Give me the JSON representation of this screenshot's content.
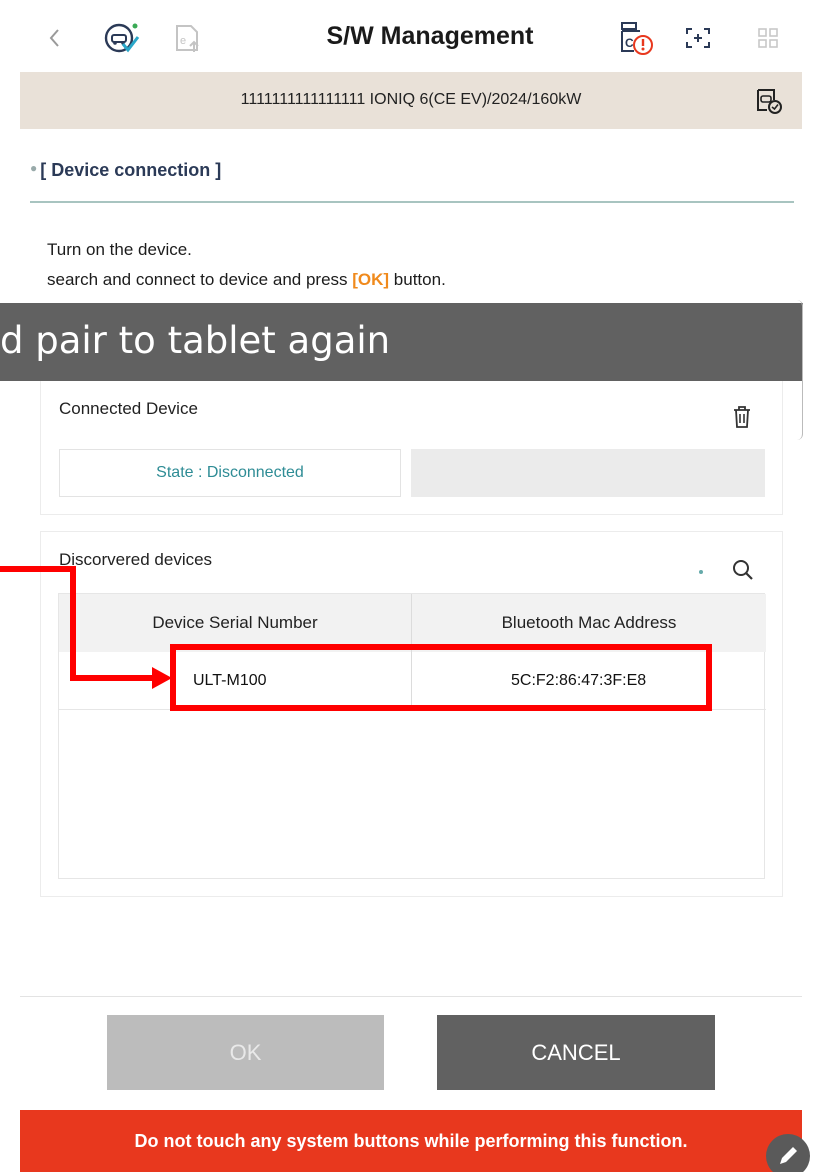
{
  "header": {
    "title": "S/W Management",
    "icons": [
      "back-chevron-icon",
      "car-repair-check-icon",
      "ecu-upload-icon",
      "vci-alert-icon",
      "screen-capture-icon",
      "grid-menu-icon"
    ],
    "vci_icon_text": "C"
  },
  "vehicle_bar": {
    "text": "1111111111111111  IONIQ 6(CE EV)/2024/160kW",
    "icon": "vehicle-status-icon"
  },
  "section": {
    "title": "[ Device connection ]"
  },
  "instructions": {
    "line1": "Turn on the device.",
    "line2_prefix": "search and connect to device and press ",
    "line2_ok": "[OK]",
    "line2_suffix": " button."
  },
  "overlay_caption": "d pair to tablet again",
  "connected_device": {
    "title": "Connected Device",
    "state": "State : Disconnected",
    "delete_icon": "trash-icon"
  },
  "discovered_devices": {
    "title": "Discorvered devices",
    "search_icon": "search-icon",
    "columns": [
      "Device Serial Number",
      "Bluetooth Mac Address"
    ],
    "rows": [
      {
        "serial": "ULT-M100",
        "mac": "5C:F2:86:47:3F:E8"
      }
    ]
  },
  "buttons": {
    "ok": "OK",
    "cancel": "CANCEL"
  },
  "warning": "Do not touch any system buttons while performing this function.",
  "colors": {
    "accent_orange": "#f08a1c",
    "warning_red": "#e8381e",
    "annotation_red": "#ff0000",
    "vehicle_bar": "#e9e1d8",
    "button_dark": "#616161",
    "button_disabled": "#bcbcbc"
  }
}
